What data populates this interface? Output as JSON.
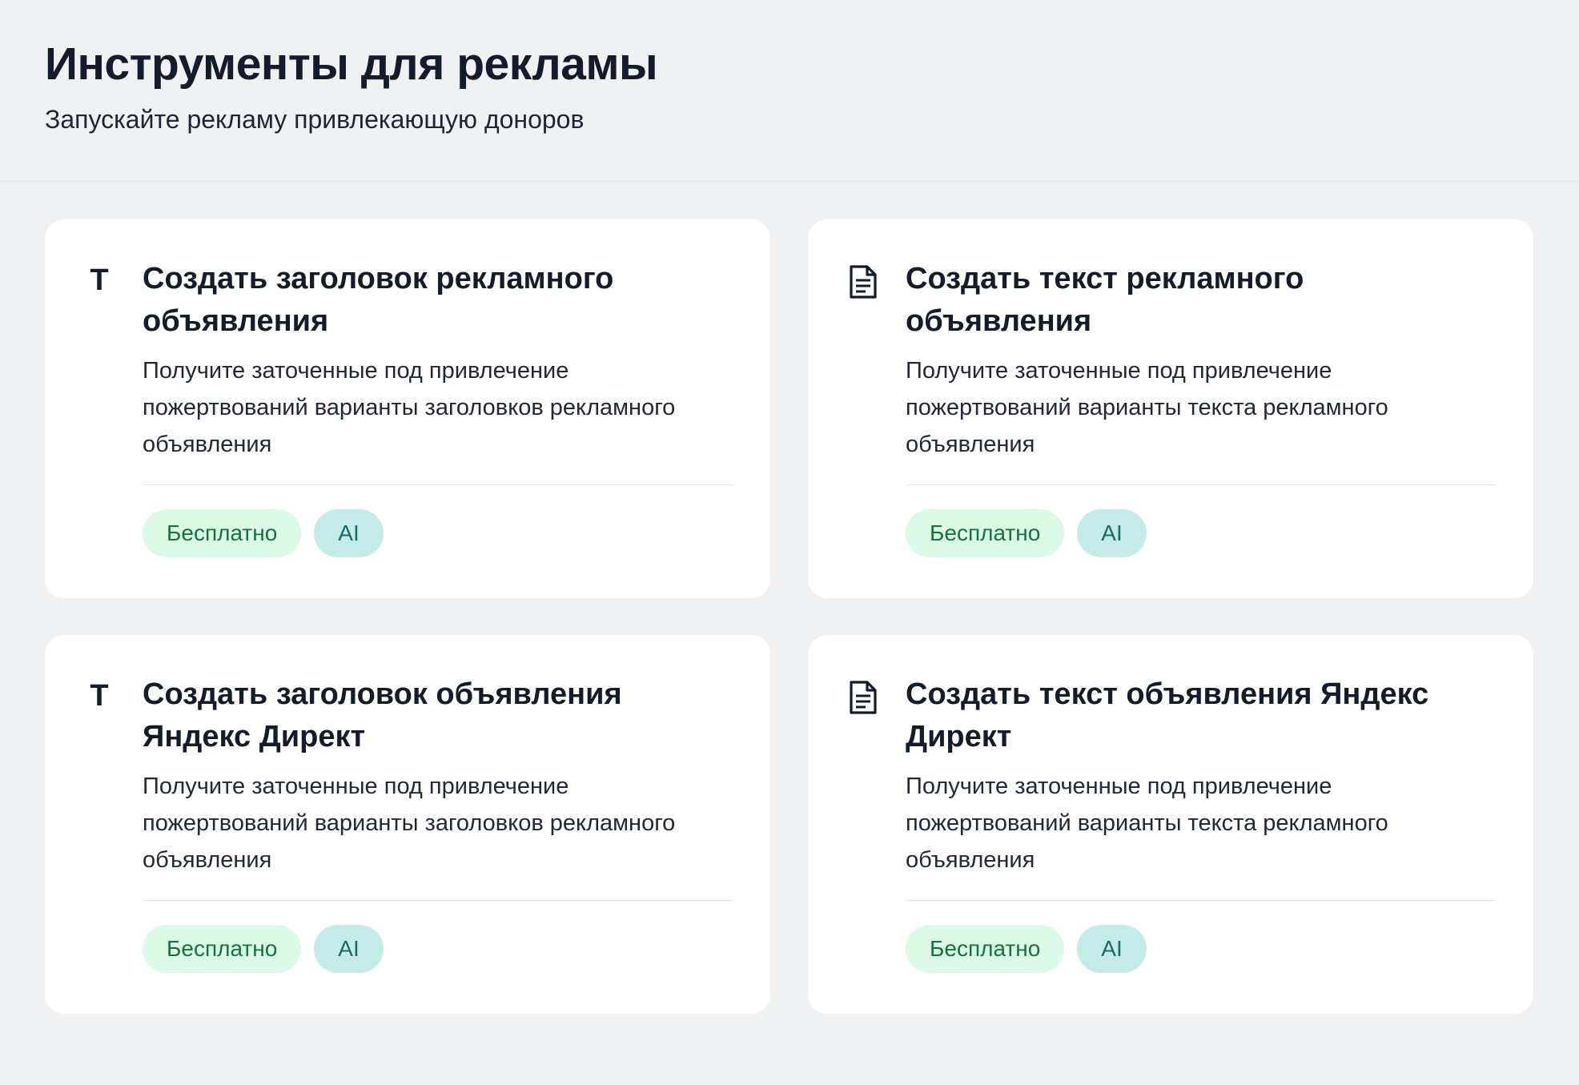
{
  "header": {
    "title": "Инструменты для рекламы",
    "subtitle": "Запускайте рекламу привлекающую доноров"
  },
  "cards": [
    {
      "icon": "text-format-icon",
      "title": "Создать заголовок рекламного объявления",
      "description": "Получите заточенные под привлечение пожертвований варианты заголовков рекламного объявления",
      "tags": [
        "Бесплатно",
        "AI"
      ]
    },
    {
      "icon": "document-icon",
      "title": "Создать текст рекламного объявления",
      "description": "Получите заточенные под привлечение пожертвований варианты текста рекламного объявления",
      "tags": [
        "Бесплатно",
        "AI"
      ]
    },
    {
      "icon": "text-format-icon",
      "title": "Создать заголовок объявления Яндекс Директ",
      "description": "Получите заточенные под привлечение пожертвований варианты заголовков рекламного объявления",
      "tags": [
        "Бесплатно",
        "AI"
      ]
    },
    {
      "icon": "document-icon",
      "title": "Создать текст объявления Яндекс Директ",
      "description": "Получите заточенные под привлечение пожертвований варианты текста рекламного объявления",
      "tags": [
        "Бесплатно",
        "AI"
      ]
    }
  ],
  "icon_glyphs": {
    "text_format": "T"
  },
  "colors": {
    "background": "#f0f1f3",
    "card": "#ffffff",
    "tag_free_bg": "#dcfbe6",
    "tag_free_text": "#13733a",
    "tag_ai_bg": "#c3ebe8",
    "tag_ai_text": "#1b6a6a"
  }
}
